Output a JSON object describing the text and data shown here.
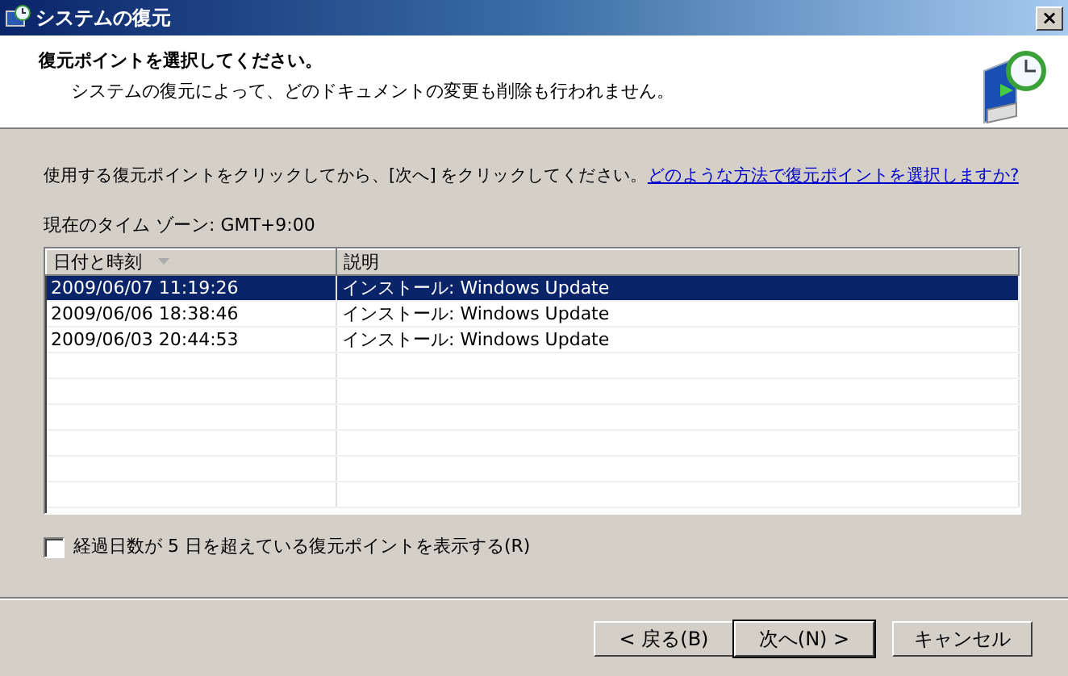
{
  "window": {
    "title": "システムの復元",
    "close": "×"
  },
  "header": {
    "title": "復元ポイントを選択してください。",
    "subtitle": "システムの復元によって、どのドキュメントの変更も削除も行われません。"
  },
  "instruction": {
    "text": "使用する復元ポイントをクリックしてから、[次へ] をクリックしてください。",
    "link": "どのような方法で復元ポイントを選択しますか?"
  },
  "timezone": "現在のタイム ゾーン: GMT+9:00",
  "table": {
    "columns": [
      "日付と時刻",
      "説明"
    ],
    "rows": [
      {
        "date": "2009/06/07 11:19:26",
        "description": "インストール: Windows Update",
        "selected": true
      },
      {
        "date": "2009/06/06 18:38:46",
        "description": "インストール: Windows Update",
        "selected": false
      },
      {
        "date": "2009/06/03 20:44:53",
        "description": "インストール: Windows Update",
        "selected": false
      }
    ]
  },
  "show_more": {
    "label": "経過日数が 5 日を超えている復元ポイントを表示する(R)",
    "checked": false
  },
  "buttons": [
    {
      "label": "< 戻る(B)",
      "default": false
    },
    {
      "label": "次へ(N) >",
      "default": true
    },
    {
      "label": "キャンセル",
      "default": false
    }
  ]
}
